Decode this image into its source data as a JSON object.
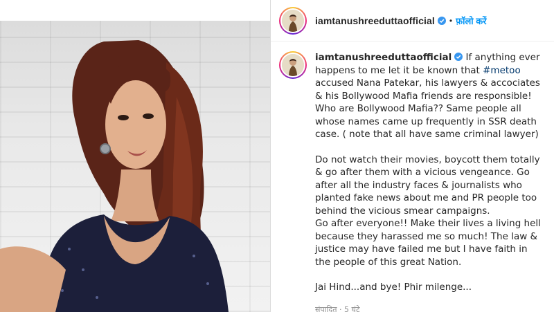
{
  "post": {
    "username": "iamtanushreeduttaofficial",
    "follow_label": "फ़ॉलो करें",
    "separator": "•"
  },
  "caption": {
    "username": "iamtanushreeduttaofficial",
    "p1_pre": " If anything ever happens to me let it be known that ",
    "hashtag": "#metoo",
    "p1_post": " accused Nana Patekar, his lawyers & accociates & his Bollywood Mafia friends are responsible! Who are Bollywood Mafia?? Same people all whose names came up frequently in SSR death case. ( note that all have same criminal lawyer)",
    "p2": "Do not watch their movies, boycott them totally & go after them with a vicious vengeance. Go after all the industry faces & journalists who planted fake news about me and PR people too behind the vicious smear campaigns.",
    "p3": "Go after everyone!! Make their lives a living hell because they harassed me so much! The law & justice may have failed me but I have faith in the people of this great Nation.",
    "p4": "Jai Hind...and bye! Phir milenge...",
    "meta": "संपादित · 5 घंटे"
  },
  "colors": {
    "follow_blue": "#0095f6",
    "verified_blue": "#3897f0",
    "hashtag": "#00376b",
    "meta_gray": "#8e8e8e"
  },
  "icons": {
    "verified": "verified-badge-icon"
  }
}
